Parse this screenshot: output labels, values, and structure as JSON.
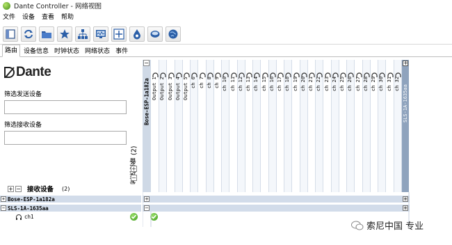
{
  "window": {
    "title": "Dante Controller - 网络视图"
  },
  "menu": {
    "items": [
      "文件",
      "设备",
      "查看",
      "帮助"
    ]
  },
  "toolbar": {
    "buttons": [
      "sidebar-icon",
      "refresh-icon",
      "folder-icon",
      "star-icon",
      "network-tree-icon",
      "monitor-icon",
      "add-grid-icon",
      "drop-icon",
      "disc-icon",
      "globe-icon"
    ]
  },
  "tabs": [
    "路由",
    "设备信息",
    "时钟状态",
    "网络状态",
    "事件"
  ],
  "active_tab": "路由",
  "logo": {
    "text": "Dante"
  },
  "filters": {
    "tx_label": "筛选发送设备",
    "tx_value": "",
    "rx_label": "筛选接收设备",
    "rx_value": ""
  },
  "transmitters": {
    "label": "发送设备",
    "count": "(2)",
    "device_name": "Bose-ESP-1a182a",
    "channels": [
      "Output 1",
      "Output 2",
      "Output 3",
      "Output 4",
      "Output 5",
      "ch 6",
      "ch 7",
      "ch 8",
      "ch 9",
      "ch 10",
      "ch 11",
      "ch 12",
      "ch 13",
      "ch 14",
      "ch 15",
      "ch 16",
      "ch 17",
      "ch 18",
      "ch 19",
      "ch 20",
      "ch 21",
      "ch 22",
      "ch 23",
      "ch 24",
      "ch 25",
      "ch 26",
      "ch 27",
      "ch 28",
      "ch 29",
      "ch 30",
      "ch 31",
      "ch 32"
    ],
    "collapsed_device_name": "SLS-1A-1635aa"
  },
  "receivers": {
    "label": "接收设备",
    "count": "(2)",
    "devices": [
      {
        "name": "Bose-ESP-1a182a",
        "expanded": false,
        "toggle": "+"
      },
      {
        "name": "SLS-1A-1635aa",
        "expanded": true,
        "toggle": "−"
      }
    ],
    "channels": [
      {
        "name": "ch1",
        "device": "SLS-1A-1635aa",
        "status": "ok",
        "routed_to": "Output 1"
      }
    ]
  },
  "watermark": {
    "text": "索尼中国 专业"
  },
  "colors": {
    "row_bg": "#d2dcea",
    "dark_col": "#8fa3bd",
    "ok_green": "#3c9b1a"
  }
}
